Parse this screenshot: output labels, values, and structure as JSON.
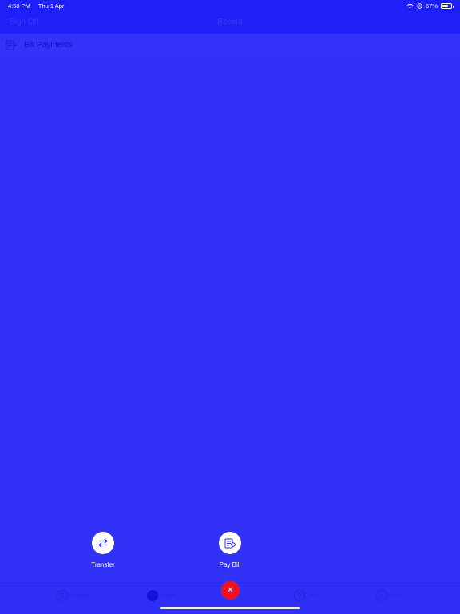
{
  "status_bar": {
    "time": "4:58 PM",
    "date": "Thu 1 Apr",
    "battery_percent": "67%",
    "battery_level": 0.67,
    "icons": [
      "wifi-icon",
      "location-icon",
      "battery-icon"
    ]
  },
  "nav": {
    "left_button": "Sign Off",
    "title": "Recent"
  },
  "list": {
    "items": [
      {
        "label": "Bill Payments",
        "icon": "bill-document-icon"
      }
    ]
  },
  "actions": [
    {
      "label": "Transfer",
      "icon": "transfer-arrows-icon"
    },
    {
      "label": "Pay Bill",
      "icon": "pay-bill-icon"
    }
  ],
  "tab_bar": {
    "tabs": [
      {
        "label": "Accounts",
        "icon": "accounts-icon"
      },
      {
        "label": "Recent",
        "icon": "recent-icon",
        "selected": true
      },
      {
        "label": "Help",
        "icon": "help-icon"
      },
      {
        "label": "More",
        "icon": "more-icon"
      }
    ],
    "close_icon": "close-icon"
  },
  "colors": {
    "background": "#3131f7",
    "bar": "#1f1ff8",
    "close_button": "#f01020",
    "text_light": "#ffffff"
  }
}
